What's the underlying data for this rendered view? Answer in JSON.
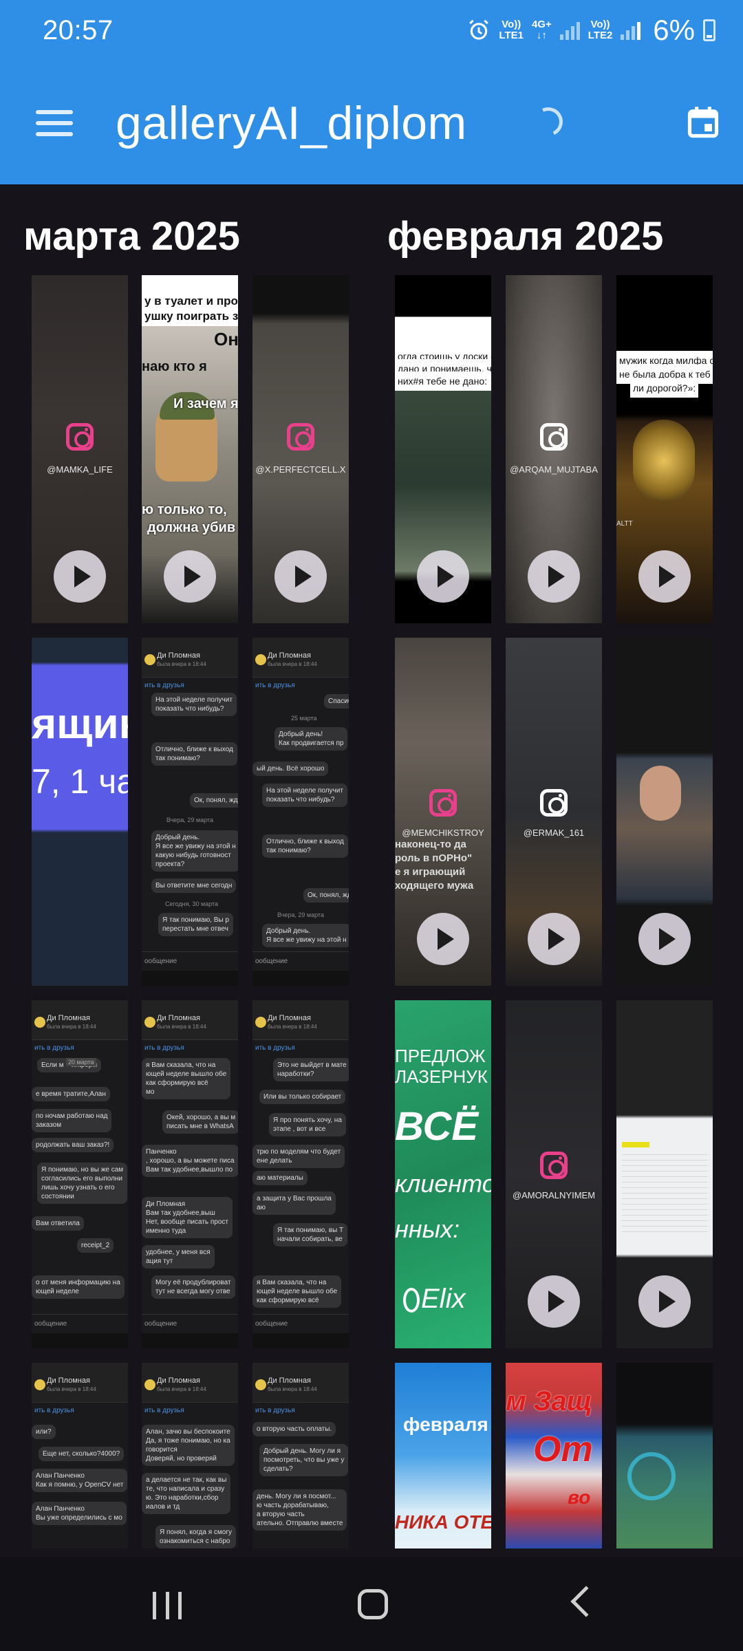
{
  "status_bar": {
    "time": "20:57",
    "sim1_top": "Vo))",
    "sim1_bottom": "LTE1",
    "network": "4G+",
    "sim2_top": "Vo))",
    "sim2_bottom": "LTE2",
    "battery": "6%"
  },
  "app_bar": {
    "title": "galleryAI_diplom",
    "bg_color": "#2f8fe6"
  },
  "sections": [
    {
      "title": "марта 2025"
    },
    {
      "title": "февраля 2025"
    }
  ],
  "thumbs": {
    "m1_ig": "@MAMKA_LIFE",
    "m2_top": "у в туалет и прошу",
    "m2_top2": "ушку поиграть за н",
    "m2_on": "Он",
    "m2_t1": "наю кто я",
    "m2_t2": "И зачем я",
    "m2_b1": "ю только то,",
    "m2_b2": "должна убив",
    "m3_ig": "@X.PERFECTCELL.X",
    "f1_t1": "огда стоишь у доски с",
    "f1_t2": "дано и понимаешь, что",
    "f1_t3": "них#я тебе не дано:",
    "f2_ig": "@ARQAM_MUJTABA",
    "f3_t1": "мужик когда милфа с",
    "f3_t2": "не была добра к теб",
    "f3_t3": "ли дорогой?»:",
    "f3_bottom": "ALTT",
    "m4_t1": "ящин",
    "m4_t2": "7, 1 ча",
    "f4_ig": "@MEMCHIKSTROY",
    "f4_t1": "наконец-то да",
    "f4_t2": "роль в пОРНо\"",
    "f4_t3": "е я играющий",
    "f4_t4": "ходящего мужа",
    "f5_ig": "@ERMAK_161",
    "f7_t1": "ПРЕДЛОЖ",
    "f7_t2": "ЛАЗЕРНУК",
    "f7_t3": "ВСЁ Т",
    "f7_t4": "клиенто",
    "f7_t5": "нных:",
    "f7_t6": "Elix",
    "f8_ig": "@AMORALNYIMEM",
    "f10_t1": "февраля",
    "f10_t2": "НИКА ОТЕ",
    "f11_t1": "м Защ",
    "f11_t2": "От",
    "f11_t3": "во"
  },
  "chat": {
    "name": "Ди Пломная",
    "sub": "была вчера в 18:44",
    "friends": "ить в друзья",
    "input": "ообщение",
    "c1_b1": "На этой неделе получит\nпоказать что нибудь?",
    "c1_b2": "Отлично, ближе к выход\nтак понимаю?",
    "c1_b3": "Ок, понял, жд",
    "c1_date": "Вчера, 29 марта",
    "c1_b4": "Добрый день.\nЯ все же увижу на этой н\nкакую нибудь готовност\nпроекта?",
    "c1_b5": "Вы ответите мне сегодн",
    "c1_date2": "Сегодня, 30 марта",
    "c1_b6": "Я так понимаю, Вы р\nперестать мне отвеч",
    "c2_b0": "Спасиб",
    "c2_date": "25 марта",
    "c2_b1": "Добрый день!\nКак продвигается пр",
    "c2_b2": "ый день. Всё хорошо",
    "c2_b3": "На этой неделе получит\nпоказать что нибудь?",
    "c2_b4": "Отлично, ближе к выход\nтак понимаю?",
    "c2_b5": "Ок, понял, жд",
    "c2_date2": "Вчера, 29 марта",
    "c2_b6": "Добрый день.\nЯ все же увижу на этой н",
    "c3_b1": "Если м    информ",
    "c3_date": "20 марта",
    "c3_b2": "е время тратите,Алан",
    "c3_b3": "по ночам работаю над\nзаказом",
    "c3_b4": "родолжать ваш заказ?!",
    "c3_b5": "Я понимаю, но вы же сам\nсогласились его выполни\nлишь хочу узнать о его\nсостоянии",
    "c3_b6": "Вам ответила",
    "c3_b7": "receipt_2",
    "c3_b8": "о от меня информацию на\nющей неделе",
    "c4_b1": "я Вам сказала, что на\nющей неделе вышло обе\nкак сформирую всё\nмо",
    "c4_b2": "Окей, хорошо, а вы м\nписать мне в WhatsA",
    "c4_b3": "Панченко\n, хорошо, а вы можете писа\nВам так удобнее,вышло по",
    "c4_b4": "Ди Пломная\nВам так удобнее,выш\nНет, вообще писать прост\nименно туда",
    "c4_b5": "удобнее, у меня вся\nация тут",
    "c4_b6": "Могу её продублироват\nтут не всегда могу отве",
    "c5_b1": "Это не выйдет в мате\nнаработки?",
    "c5_b2": "Или вы только собирает",
    "c5_b3": "Я про понять хочу, на\nэтапе , вот и все",
    "c5_b4": "трю по моделям что будет\nене делать",
    "c5_b5": "аю материалы",
    "c5_b6": "а защита у Вас прошла\nаю",
    "c5_b7": "Я так понимаю, вы Т\nначали собирать, ве",
    "c5_b8": "я Вам сказала, что на\nющей неделе вышло обе\nкак сформирую всё",
    "c6_b1": "или?",
    "c6_b2": "Еще нет, сколько?4000?",
    "c6_b3": "Алан Панченко\nКак я помню, у OpenCV нет",
    "c6_b4": "Алан Панченко\nВы уже определились с мо",
    "c7_b1": "Алан, зачю вы беспокоите\nДа, я тоже понимаю, но ка\nговорится\nДоверяй, но проверяй",
    "c7_b2": "а делается не так, как вы\nте, что написала и сразу\nю. Это наработки,сбор\nиалов и тд",
    "c7_b3": "Я понял, когда я смогу\nознакомиться с набро",
    "c8_b1": "о вторую часть оплаты.",
    "c8_b2": "Добрый день. Могу ли я\nпосмотреть, что вы уже у\nсделать?",
    "c8_b3": "день. Могу ли я посмот...\nю часть дорабатываю,\nа вторую часть\nательно. Отправлю вместе"
  }
}
